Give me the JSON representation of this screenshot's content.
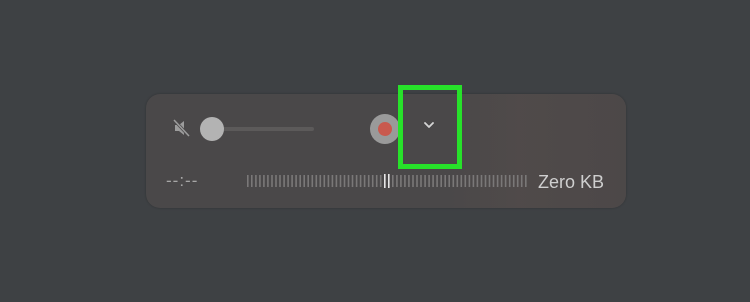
{
  "recorder": {
    "mute_icon": "speaker-muted-icon",
    "volume_level": 0.0,
    "record_icon": "record-dot-icon",
    "options_icon": "chevron-down-icon",
    "time": "--:--",
    "file_size": "Zero KB",
    "colors": {
      "record": "#c9594e",
      "highlight": "#27e22a"
    }
  }
}
